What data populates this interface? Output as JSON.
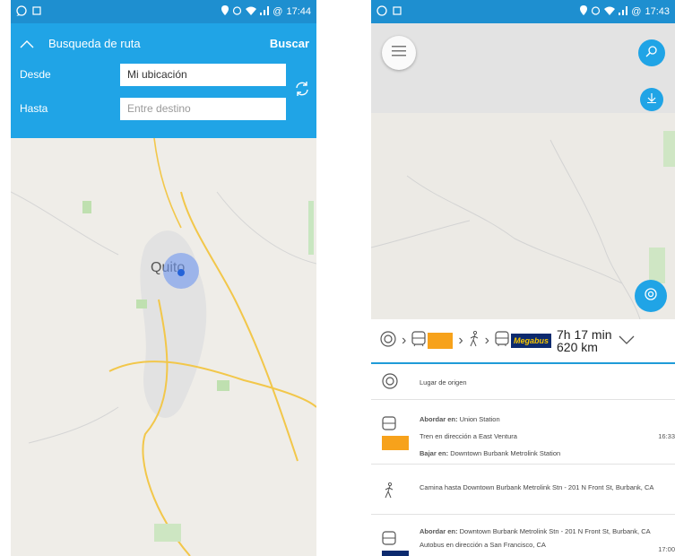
{
  "left_screen": {
    "status_bar": {
      "time": "17:44",
      "battery": "@"
    },
    "header": {
      "title": "Busqueda de ruta",
      "search_label": "Buscar",
      "from_label": "Desde",
      "from_value": "Mi ubicación",
      "to_label": "Hasta",
      "to_placeholder": "Entre destino"
    },
    "map": {
      "city_label": "Quito"
    }
  },
  "right_screen": {
    "status_bar": {
      "time": "17:43",
      "battery": "@"
    },
    "route_summary": {
      "steps": [
        "origin-icon",
        "train-icon",
        "walk-icon",
        "bus-icon"
      ],
      "carrier_badge": "Megabus",
      "duration": "7h 17 min",
      "distance": "620 km",
      "train_color": "#f7a21b",
      "bus_brand_color": "#0c2a6e"
    },
    "itinerary": [
      {
        "type": "origin",
        "text": "Lugar de origen"
      },
      {
        "type": "train",
        "board_label": "Abordar en:",
        "board_value": "Union Station",
        "direction": "Tren en dirección a East Ventura",
        "alight_label": "Bajar en:",
        "alight_value": "Downtown Burbank Metrolink Station",
        "time": "16:33"
      },
      {
        "type": "walk",
        "text": "Camina hasta Downtown Burbank Metrolink Stn - 201 N Front St, Burbank, CA"
      },
      {
        "type": "bus",
        "board_label": "Abordar en:",
        "board_value": "Downtown Burbank Metrolink Stn - 201 N Front St, Burbank, CA",
        "direction": "Autobus en dirección a San Francisco, CA",
        "time": "17:00"
      }
    ]
  },
  "colors": {
    "primary": "#20a4e6",
    "statusbar": "#1e8fd0",
    "accent_line": "#1f9bd8"
  }
}
